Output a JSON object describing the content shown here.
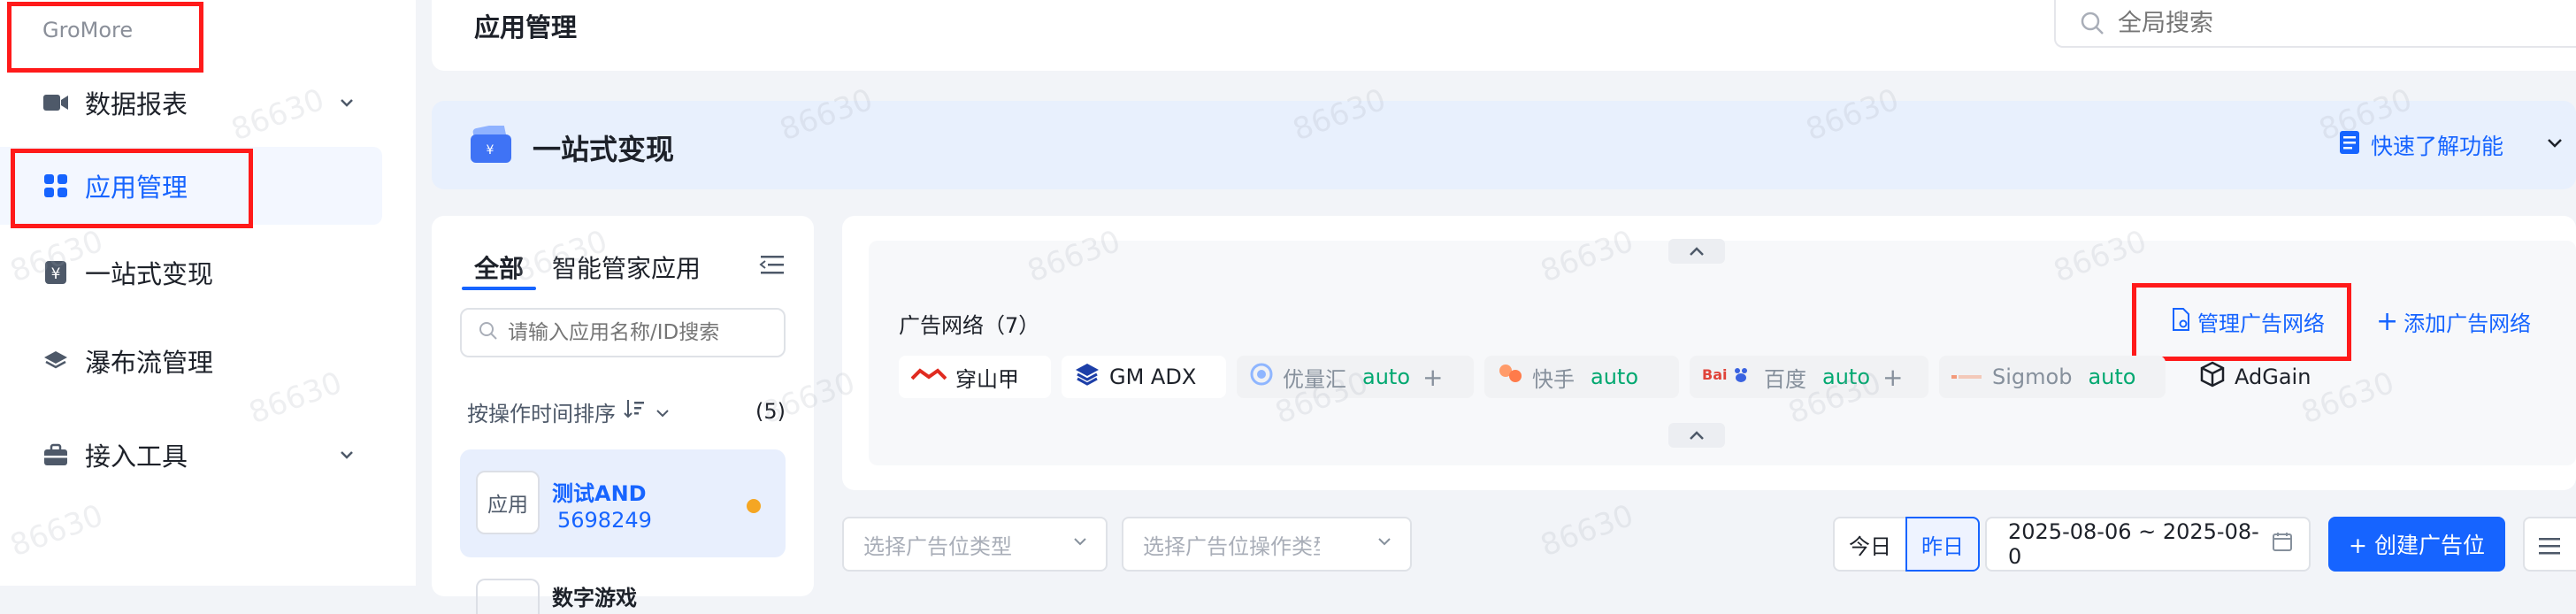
{
  "sidebar": {
    "brand": "GroMore",
    "items": [
      {
        "label": "数据报表",
        "icon": "video-report-icon",
        "has_children": true
      },
      {
        "label": "应用管理",
        "icon": "app-grid-icon",
        "active": true
      },
      {
        "label": "一站式变现",
        "icon": "yen-icon"
      },
      {
        "label": "瀑布流管理",
        "icon": "layers-icon"
      },
      {
        "label": "接入工具",
        "icon": "toolbox-icon",
        "has_children": true
      }
    ]
  },
  "header": {
    "title": "应用管理",
    "search_placeholder": "全局搜索"
  },
  "banner": {
    "title": "一站式变现",
    "quick_link": "快速了解功能"
  },
  "apps_panel": {
    "tabs": [
      "全部",
      "智能管家应用"
    ],
    "active_tab": 0,
    "search_placeholder": "请输入应用名称/ID搜索",
    "sort_label": "按操作时间排序",
    "count": "(5)",
    "apps": [
      {
        "avatar": "应用",
        "name": "测试AND",
        "id": "5698249",
        "status_color": "#f5a623"
      },
      {
        "name": "数字游戏"
      }
    ]
  },
  "ad_networks": {
    "title": "广告网络（7）",
    "manage_label": "管理广告网络",
    "add_label": "添加广告网络",
    "networks": [
      {
        "name": "穿山甲",
        "icon": "pangle-icon"
      },
      {
        "name": "GM ADX",
        "icon": "gm-adx-icon"
      },
      {
        "name": "优量汇",
        "icon": "ylh-icon",
        "badge": "auto",
        "dim": true
      },
      {
        "name": "快手",
        "icon": "kuaishou-icon",
        "badge": "auto",
        "dim": true
      },
      {
        "name": "百度",
        "icon": "baidu-icon",
        "badge": "auto",
        "dim": true
      },
      {
        "name": "Sigmob",
        "icon": "sigmob-icon",
        "badge": "auto",
        "dim": true
      },
      {
        "name": "AdGain",
        "icon": "adgain-icon"
      }
    ]
  },
  "filters": {
    "slot_type_placeholder": "选择广告位类型",
    "slot_op_placeholder": "选择广告位操作类型",
    "today": "今日",
    "yesterday": "昨日",
    "date_range": "2025-08-06 ~ 2025-08-0",
    "create_label": "+ 创建广告位"
  },
  "watermark": "86630",
  "colors": {
    "primary": "#1664ff",
    "highlight_box": "#ff1a1a",
    "auto_badge": "#00a870"
  }
}
